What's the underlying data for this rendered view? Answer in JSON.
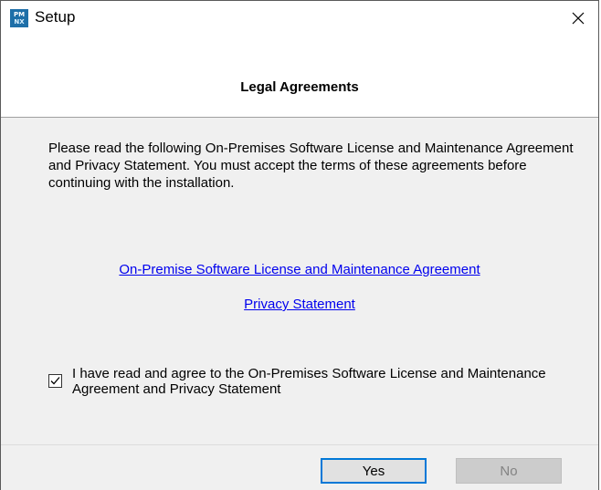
{
  "window": {
    "title": "Setup",
    "icon_name": "app-setup-icon",
    "icon_text_top": "PM",
    "icon_text_bottom": "NX",
    "close_glyph": "✕"
  },
  "header": {
    "title": "Legal Agreements"
  },
  "intro_text": "Please read the following On-Premises Software License and Maintenance Agreement and Privacy Statement. You must accept the terms of these agreements before continuing with the installation.",
  "links": {
    "license": "On-Premise Software License and Maintenance Agreement",
    "privacy": "Privacy Statement"
  },
  "agreement": {
    "checked": true,
    "label": "I have read and agree to the On-Premises Software License and Maintenance Agreement and Privacy Statement"
  },
  "buttons": {
    "yes": "Yes",
    "no": "No"
  },
  "colors": {
    "link": "#0000ee",
    "focus_border": "#0078d7",
    "dialog_bg": "#f0f0f0"
  }
}
